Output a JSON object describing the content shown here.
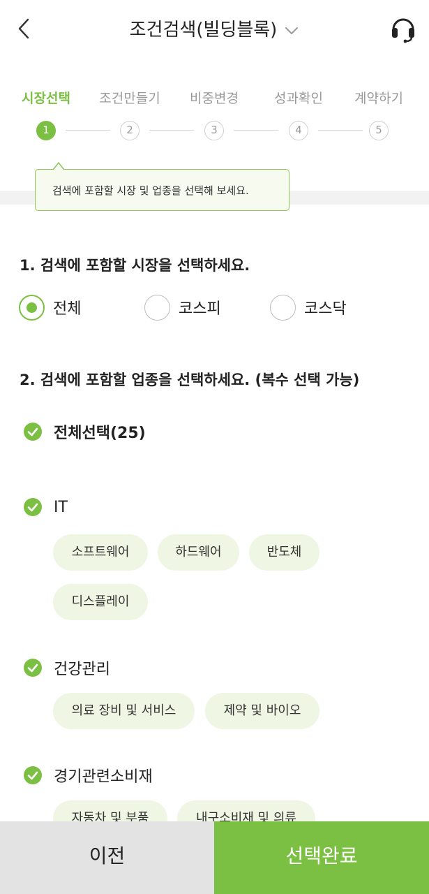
{
  "header": {
    "title": "조건검색(빌딩블록)",
    "back_icon": "chevron-left-icon",
    "dropdown_icon": "chevron-down-icon",
    "support_icon": "headset-icon"
  },
  "steps": [
    {
      "label": "시장선택",
      "number": "1",
      "active": true
    },
    {
      "label": "조건만들기",
      "number": "2",
      "active": false
    },
    {
      "label": "비중변경",
      "number": "3",
      "active": false
    },
    {
      "label": "성과확인",
      "number": "4",
      "active": false
    },
    {
      "label": "계약하기",
      "number": "5",
      "active": false
    }
  ],
  "tooltip": {
    "text": "검색에 포함할 시장 및 업종을 선택해 보세요."
  },
  "market_section": {
    "title": "1. 검색에 포함할 시장을 선택하세요.",
    "options": [
      {
        "label": "전체",
        "selected": true
      },
      {
        "label": "코스피",
        "selected": false
      },
      {
        "label": "코스닥",
        "selected": false
      }
    ]
  },
  "sector_section": {
    "title": "2. 검색에 포함할 업종을 선택하세요. (복수 선택 가능)",
    "select_all": "전체선택(25)",
    "categories": [
      {
        "label": "IT",
        "checked": true,
        "chips": [
          "소프트웨어",
          "하드웨어",
          "반도체",
          "디스플레이"
        ]
      },
      {
        "label": "건강관리",
        "checked": true,
        "chips": [
          "의료 장비 및 서비스",
          "제약 및 바이오"
        ]
      },
      {
        "label": "경기관련소비재",
        "checked": true,
        "chips": [
          "자동차 및 부품",
          "내구소비재 및 의류"
        ]
      }
    ]
  },
  "footer": {
    "prev_label": "이전",
    "done_label": "선택완료"
  },
  "colors": {
    "accent": "#7cc043",
    "chip_bg": "#f0f6e4",
    "prev_bg": "#e3e3e3"
  }
}
